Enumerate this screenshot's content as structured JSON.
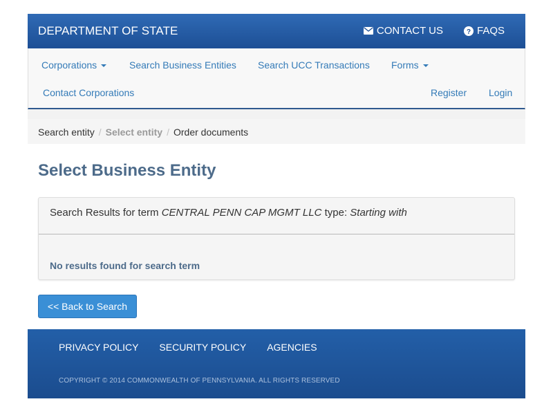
{
  "header": {
    "title": "DEPARTMENT OF STATE",
    "links": [
      {
        "label": "CONTACT US",
        "icon": "envelope-icon"
      },
      {
        "label": "FAQS",
        "icon": "question-circle-icon"
      }
    ]
  },
  "nav": {
    "corporations": "Corporations",
    "search_business": "Search Business Entities",
    "search_ucc": "Search UCC Transactions",
    "forms": "Forms",
    "contact_corporations": "Contact Corporations",
    "register": "Register",
    "login": "Login"
  },
  "breadcrumb": {
    "items": [
      {
        "label": "Search entity",
        "active": false
      },
      {
        "label": "Select entity",
        "active": true
      },
      {
        "label": "Order documents",
        "active": false
      }
    ],
    "separator": "/"
  },
  "main": {
    "title": "Select Business Entity",
    "results": {
      "prefix": "Search Results for term ",
      "term": "CENTRAL PENN CAP MGMT LLC",
      "type_label": " type: ",
      "type_value": "Starting with",
      "message": "No results found for search term"
    },
    "back_button": "<< Back to Search"
  },
  "footer": {
    "links": [
      "PRIVACY POLICY",
      "SECURITY POLICY",
      "AGENCIES"
    ],
    "copyright": "COPYRIGHT © 2014 COMMONWEALTH OF PENNSYLVANIA. ALL RIGHTS RESERVED"
  },
  "colors": {
    "header_blue": "#1d4f95",
    "link_blue": "#337ab7",
    "button_blue": "#3a8fd6",
    "title_slate": "#4d6b8a"
  }
}
